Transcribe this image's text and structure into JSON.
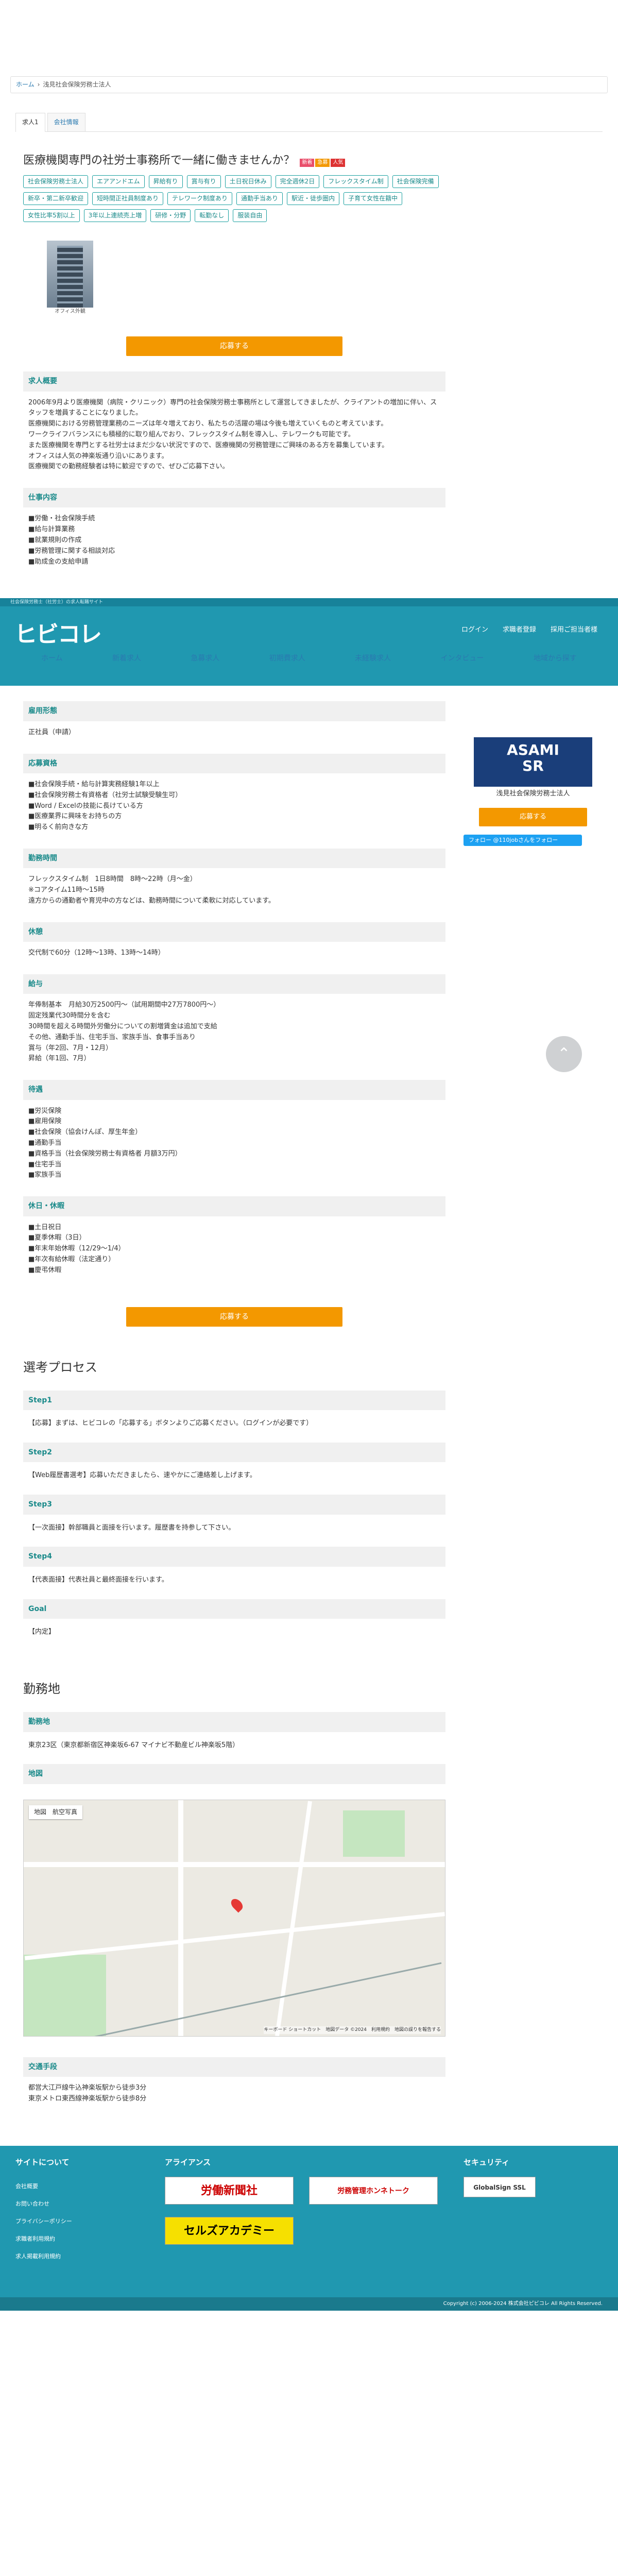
{
  "breadcrumb": {
    "home": "ホーム",
    "current": "浅見社会保険労務士法人"
  },
  "tabs": [
    "求人1",
    "会社情報"
  ],
  "headline": "医療機関専門の社労士事務所で一緒に働きませんか？",
  "new_badges": [
    "新着",
    "急募",
    "人気"
  ],
  "tags": [
    "社会保険労務士法人",
    "エアアンドエム",
    "昇給有り",
    "賞与有り",
    "土日祝日休み",
    "完全週休2日",
    "フレックスタイム制",
    "社会保険完備",
    "新卒・第二新卒歓迎",
    "短時間正社員制度あり",
    "テレワーク制度あり",
    "通勤手当あり",
    "駅近・徒歩圏内",
    "子育て女性在籍中",
    "女性比率5割以上",
    "3年以上連続売上増",
    "研修・分野",
    "転勤なし",
    "服装自由"
  ],
  "photo_caption": "オフィス外観",
  "apply_label": "応募する",
  "sections1": [
    {
      "title": "求人概要",
      "body": "2006年9月より医療機関（病院・クリニック）専門の社会保険労務士事務所として運営してきましたが、クライアントの増加に伴い、スタッフを増員することになりました。\n医療機関における労務管理業務のニーズは年々増えており、私たちの活躍の場は今後も増えていくものと考えています。\nワークライフバランスにも積極的に取り組んでおり、フレックスタイム制を導入し、テレワークも可能です。\nまた医療機関を専門とする社労士はまだ少ない状況ですので、医療機関の労務管理にご興味のある方を募集しています。\nオフィスは人気の神楽坂通り沿いにあります。\n医療機関での勤務経験者は特に歓迎ですので、ぜひご応募下さい。"
    },
    {
      "title": "仕事内容",
      "body": "■労働・社会保険手続\n■給与計算業務\n■就業規則の作成\n■労務管理に関する相談対応\n■助成金の支給申請"
    }
  ],
  "header": {
    "strip": "社会保険労務士（社労士）の求人転職サイト",
    "logo": "ヒビコレ",
    "links": [
      "ログイン",
      "求職者登録",
      "採用ご担当者様"
    ],
    "nav": [
      "ホーム",
      "新着求人",
      "急募求人",
      "初期費求人",
      "未経験求人",
      "インタビュー",
      "地域から探す"
    ]
  },
  "sidebar": {
    "logo_top": "ASAMI",
    "logo_bottom": "SR",
    "name": "浅見社会保険労務士法人",
    "apply": "応募する",
    "tweet": "フォロー @110jobさんをフォロー"
  },
  "sections2": [
    {
      "title": "雇用形態",
      "body": "正社員（申請）"
    },
    {
      "title": "応募資格",
      "body": "■社会保険手続・給与計算実務経験1年以上\n■社会保険労務士有資格者（社労士試験受験生可）\n■Word / Excelの技能に長けている方\n■医療業界に興味をお持ちの方\n■明るく前向きな方"
    },
    {
      "title": "勤務時間",
      "body": "フレックスタイム制　1日8時間　8時〜22時（月〜金）\n※コアタイム11時〜15時\n遠方からの通勤者や育児中の方などは、勤務時間について柔軟に対応しています。"
    },
    {
      "title": "休憩",
      "body": "交代制で60分（12時〜13時、13時〜14時）"
    },
    {
      "title": "給与",
      "body": "年俸制基本　月給30万2500円〜（試用期間中27万7800円〜）\n固定残業代30時間分を含む\n30時間を超える時間外労働分についての割増賃金は追加で支給\nその他、通勤手当、住宅手当、家族手当、食事手当あり\n賞与（年2回、7月・12月）\n昇給（年1回、7月）"
    },
    {
      "title": "待遇",
      "body": "■労災保険\n■雇用保険\n■社会保険（協会けんぽ、厚生年金）\n■通勤手当\n■資格手当（社会保険労務士有資格者 月額3万円）\n■住宅手当\n■家族手当"
    },
    {
      "title": "休日・休暇",
      "body": "■土日祝日\n■夏季休暇（3日）\n■年末年始休暇（12/29〜1/4）\n■年次有給休暇（法定通り）\n■慶弔休暇"
    }
  ],
  "process_title": "選考プロセス",
  "steps": [
    {
      "title": "Step1",
      "body": "【応募】まずは、ヒビコレの「応募する」ボタンよりご応募ください。（ログインが必要です）"
    },
    {
      "title": "Step2",
      "body": "【Web履歴書選考】応募いただきましたら、速やかにご連絡差し上げます。"
    },
    {
      "title": "Step3",
      "body": "【一次面接】幹部職員と面接を行います。履歴書を持参して下さい。"
    },
    {
      "title": "Step4",
      "body": "【代表面接】代表社員と最終面接を行います。"
    },
    {
      "title": "Goal",
      "body": "【内定】"
    }
  ],
  "location_title": "勤務地",
  "location": [
    {
      "title": "勤務地",
      "body": "東京23区（東京都新宿区神楽坂6-67 マイナビ不動産ビル神楽坂5階）"
    },
    {
      "title": "地図",
      "body": ""
    }
  ],
  "map": {
    "tab_map": "地図",
    "tab_photo": "航空写真",
    "attribution": "キーボード ショートカット　地図データ ©2024　利用規約　地図の誤りを報告する"
  },
  "access": {
    "title": "交通手段",
    "body": "都営大江戸線牛込神楽坂駅から徒歩3分\n東京メトロ東西線神楽坂駅から徒歩8分"
  },
  "footer": {
    "col1_title": "サイトについて",
    "col2_title": "アライアンス",
    "col3_title": "セキュリティ",
    "links": [
      "会社概要",
      "お問い合わせ",
      "プライバシーポリシー",
      "求職者利用規約",
      "求人掲載利用規約"
    ],
    "banners": [
      "労働新聞社",
      "労務管理ホンネトーク",
      "セルズアカデミー"
    ],
    "ssl": "GlobalSign SSL",
    "copyright": "Copyright (c) 2006-2024 株式会社ピビコレ All Rights Reserved."
  }
}
